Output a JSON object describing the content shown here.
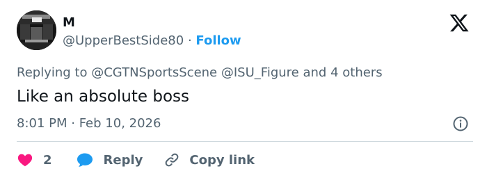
{
  "author": {
    "display_name": "M",
    "handle": "@UpperBestSide80",
    "separator": "·",
    "follow_label": "Follow"
  },
  "icons": {
    "brand": "x-logo-icon",
    "info": "info-icon",
    "like": "heart-icon",
    "reply": "speech-bubble-icon",
    "copy": "link-icon"
  },
  "reply_context": {
    "prefix": "Replying to",
    "mentions": [
      "@CGTNSportsScene",
      "@ISU_Figure"
    ],
    "suffix": "and 4 others"
  },
  "tweet": {
    "text": "Like an absolute boss",
    "timestamp": "8:01 PM · Feb 10, 2026"
  },
  "actions": {
    "like_count": "2",
    "reply_label": "Reply",
    "copy_link_label": "Copy link"
  },
  "colors": {
    "accent": "#1d9bf0",
    "like": "#f91880",
    "text": "#0f1419",
    "muted": "#536471",
    "divider": "#cfd9de"
  }
}
